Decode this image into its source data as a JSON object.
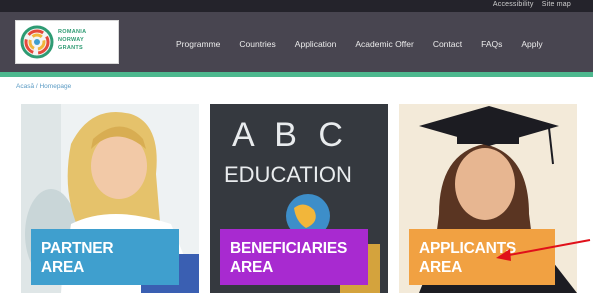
{
  "top_links": [
    "Accessibility",
    "Site map"
  ],
  "logo": {
    "text_lines": [
      "ROMANIA",
      "NORWAY",
      "GRANTS"
    ],
    "icon": "logo-circle-icon"
  },
  "nav": {
    "items": [
      "Programme",
      "Countries",
      "Application",
      "Academic Offer",
      "Contact",
      "FAQs",
      "Apply"
    ]
  },
  "breadcrumb": "Acasă / Homepage",
  "tiles": [
    {
      "line1": "PARTNER",
      "line2": "AREA",
      "color": "#3f9fce"
    },
    {
      "line1": "BENEFICIARIES",
      "line2": "AREA",
      "color": "#a82ad0"
    },
    {
      "line1": "APPLICANTS",
      "line2": "AREA",
      "color": "#f1a142"
    }
  ],
  "photo2": {
    "chalk_line1": "A B C",
    "chalk_line2": "EDUCATION"
  },
  "colors": {
    "header": "#484550",
    "accent_green": "#4db88e",
    "arrow": "#e0101a"
  }
}
